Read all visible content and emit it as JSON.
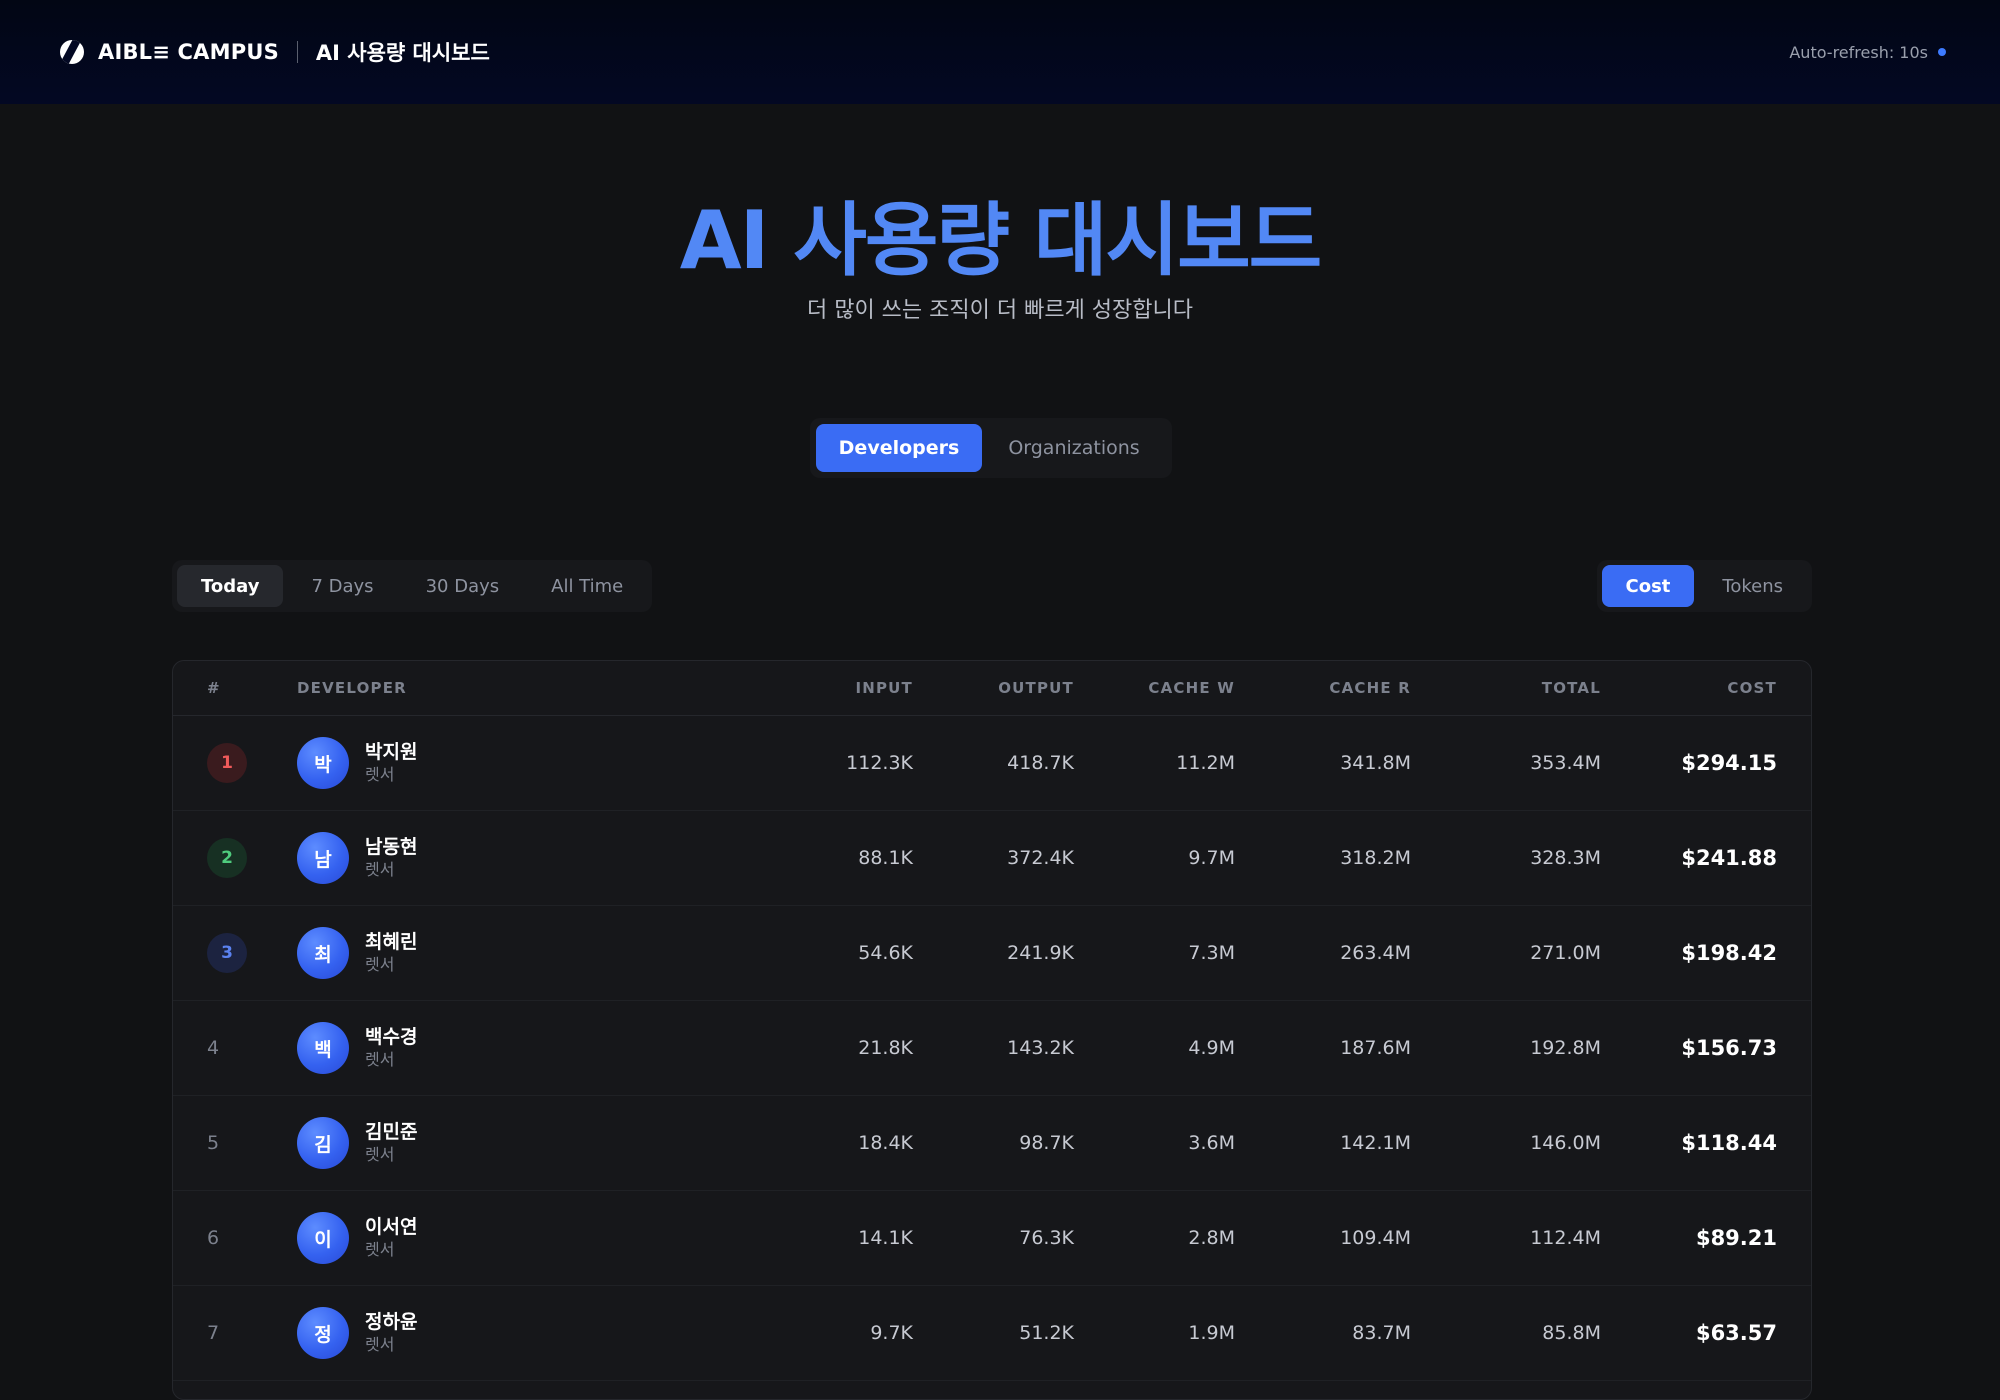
{
  "header": {
    "brand": "AIBL≡ CAMPUS",
    "title": "AI 사용량 대시보드",
    "refresh": "Auto-refresh: 10s"
  },
  "hero": {
    "title": "AI 사용량 대시보드",
    "subtitle": "더 많이 쓰는 조직이 더 빠르게 성장합니다"
  },
  "view_tabs": [
    "Developers",
    "Organizations"
  ],
  "period_tabs": [
    "Today",
    "7 Days",
    "30 Days",
    "All Time"
  ],
  "metric_tabs": [
    "Cost",
    "Tokens"
  ],
  "table": {
    "headers": [
      "#",
      "DEVELOPER",
      "INPUT",
      "OUTPUT",
      "CACHE W",
      "CACHE R",
      "TOTAL",
      "COST"
    ],
    "rows": [
      {
        "rank": "1",
        "initial": "박",
        "name": "박지원",
        "org": "렛서",
        "input": "112.3K",
        "output": "418.7K",
        "cache_w": "11.2M",
        "cache_r": "341.8M",
        "total": "353.4M",
        "cost": "$294.15"
      },
      {
        "rank": "2",
        "initial": "남",
        "name": "남동현",
        "org": "렛서",
        "input": "88.1K",
        "output": "372.4K",
        "cache_w": "9.7M",
        "cache_r": "318.2M",
        "total": "328.3M",
        "cost": "$241.88"
      },
      {
        "rank": "3",
        "initial": "최",
        "name": "최혜린",
        "org": "렛서",
        "input": "54.6K",
        "output": "241.9K",
        "cache_w": "7.3M",
        "cache_r": "263.4M",
        "total": "271.0M",
        "cost": "$198.42"
      },
      {
        "rank": "4",
        "initial": "백",
        "name": "백수경",
        "org": "렛서",
        "input": "21.8K",
        "output": "143.2K",
        "cache_w": "4.9M",
        "cache_r": "187.6M",
        "total": "192.8M",
        "cost": "$156.73"
      },
      {
        "rank": "5",
        "initial": "김",
        "name": "김민준",
        "org": "렛서",
        "input": "18.4K",
        "output": "98.7K",
        "cache_w": "3.6M",
        "cache_r": "142.1M",
        "total": "146.0M",
        "cost": "$118.44"
      },
      {
        "rank": "6",
        "initial": "이",
        "name": "이서연",
        "org": "렛서",
        "input": "14.1K",
        "output": "76.3K",
        "cache_w": "2.8M",
        "cache_r": "109.4M",
        "total": "112.4M",
        "cost": "$89.21"
      },
      {
        "rank": "7",
        "initial": "정",
        "name": "정하윤",
        "org": "렛서",
        "input": "9.7K",
        "output": "51.2K",
        "cache_w": "1.9M",
        "cache_r": "83.7M",
        "total": "85.8M",
        "cost": "$63.57"
      }
    ]
  },
  "colors": {
    "accent": "#3a6cf4",
    "hero_title": "#5288f5",
    "rank_1": "#ef5a5a",
    "rank_2": "#4fcb7d",
    "rank_3": "#5b82f0"
  }
}
